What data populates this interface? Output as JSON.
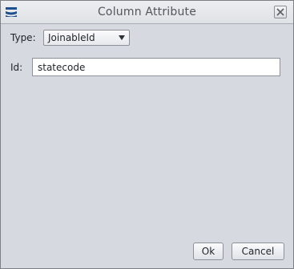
{
  "window": {
    "title": "Column Attribute"
  },
  "form": {
    "type_label": "Type:",
    "type_value": "JoinableId",
    "id_label": "Id:",
    "id_value": "statecode"
  },
  "buttons": {
    "ok_label": "Ok",
    "cancel_label": "Cancel"
  },
  "icons": {
    "app": "app-menu-icon",
    "close": "close-icon",
    "dropdown": "chevron-down-icon"
  }
}
